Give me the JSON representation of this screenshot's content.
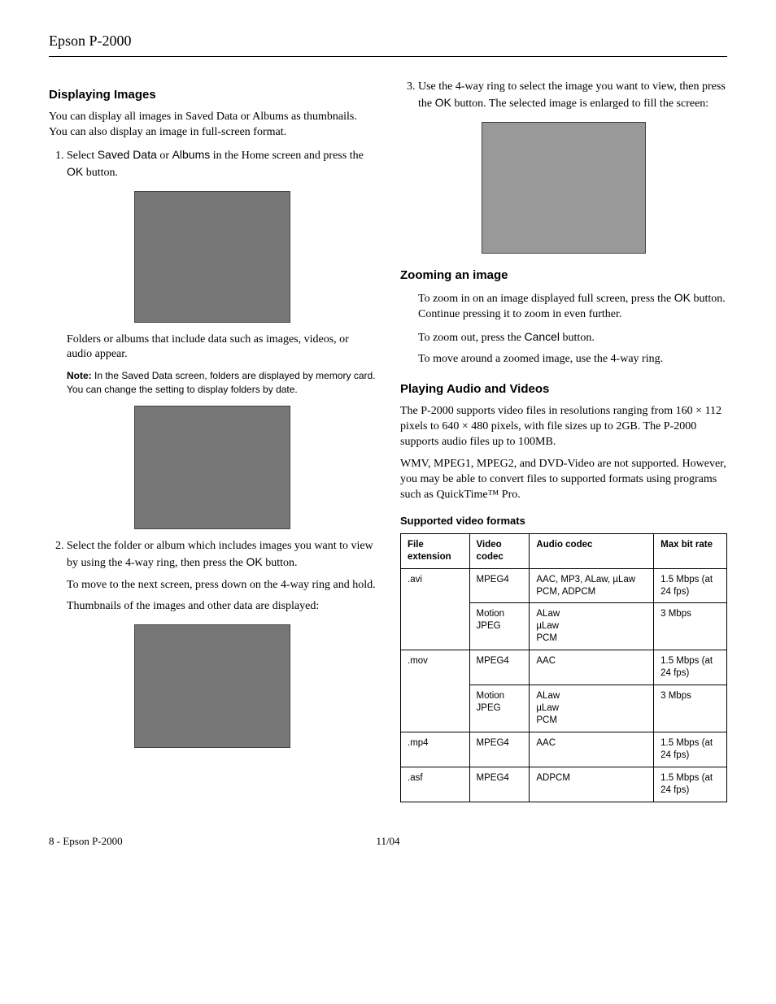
{
  "header": "Epson P-2000",
  "left": {
    "h_displaying": "Displaying Images",
    "p_intro": "You can display all images in Saved Data or Albums as thumbnails. You can also display an image in full-screen format.",
    "step1_a": "Select ",
    "step1_b": "Saved Data",
    "step1_c": " or ",
    "step1_d": "Albums",
    "step1_e": " in the Home screen and press the ",
    "step1_f": "OK",
    "step1_g": " button.",
    "p_folders": "Folders or albums that include data such as images, videos, or audio appear.",
    "note_label": "Note:",
    "note_text": " In the Saved Data screen, folders are displayed by memory card. You can change the setting to display folders by date.",
    "step2_a": "Select the folder or album which includes images you want to view by using the 4-way ring, then press the ",
    "step2_b": "OK",
    "step2_c": " button.",
    "p_move": "To move to the next screen, press down on the 4-way ring and hold.",
    "p_thumbs": "Thumbnails of the images and other data are displayed:"
  },
  "right": {
    "step3_a": "Use the 4-way ring to select the image you want to view, then press the ",
    "step3_b": "OK",
    "step3_c": " button. The selected image is enlarged to fill the screen:",
    "h_zoom": "Zooming an image",
    "zoom1_a": "To zoom in on an image displayed full screen, press the ",
    "zoom1_b": "OK",
    "zoom1_c": " button. Continue pressing it to zoom in even further.",
    "zoom2_a": "To zoom out, press the ",
    "zoom2_b": "Cancel",
    "zoom2_c": " button.",
    "zoom3": "To move around a zoomed image, use the 4-way ring.",
    "h_play": "Playing Audio and Videos",
    "play_p1": "The P-2000 supports video files in resolutions ranging from 160 × 112 pixels to 640 × 480 pixels, with file sizes up to 2GB. The P-2000 supports audio files up to 100MB.",
    "play_p2": "WMV, MPEG1, MPEG2, and DVD-Video are not supported. However, you may be able to convert files to supported formats using programs such as QuickTime™ Pro.",
    "h_table": "Supported video formats",
    "th1": "File extension",
    "th2": "Video codec",
    "th3": "Audio codec",
    "th4": "Max bit rate",
    "rows": [
      {
        "ext": ".avi",
        "vc": "MPEG4",
        "ac": "AAC, MP3, ALaw, µLaw PCM, ADPCM",
        "br": "1.5 Mbps (at 24 fps)",
        "rowspan": 2
      },
      {
        "ext": "",
        "vc": "Motion JPEG",
        "ac": "ALaw\nµLaw\nPCM",
        "br": "3 Mbps"
      },
      {
        "ext": ".mov",
        "vc": "MPEG4",
        "ac": "AAC",
        "br": "1.5 Mbps (at 24 fps)",
        "rowspan": 2
      },
      {
        "ext": "",
        "vc": "Motion JPEG",
        "ac": "ALaw\nµLaw\nPCM",
        "br": "3 Mbps"
      },
      {
        "ext": ".mp4",
        "vc": "MPEG4",
        "ac": "AAC",
        "br": "1.5 Mbps (at 24 fps)"
      },
      {
        "ext": ".asf",
        "vc": "MPEG4",
        "ac": "ADPCM",
        "br": "1.5 Mbps (at 24 fps)"
      }
    ]
  },
  "footer": {
    "left": "8 - Epson P-2000",
    "center": "11/04"
  }
}
